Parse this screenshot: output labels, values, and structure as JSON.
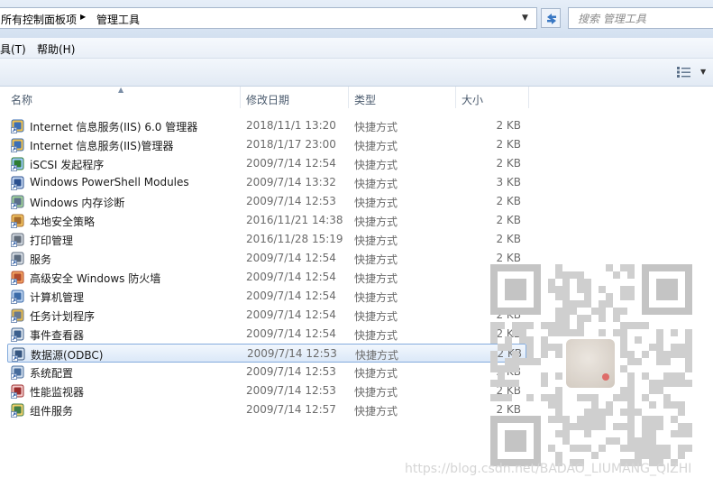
{
  "window": {
    "breadcrumb": [
      "所有控制面板项",
      "管理工具"
    ],
    "search_placeholder": "搜索 管理工具"
  },
  "menu": [
    {
      "label": "具(T)"
    },
    {
      "label": "帮助(H)"
    }
  ],
  "columns": [
    {
      "key": "name",
      "label": "名称"
    },
    {
      "key": "date",
      "label": "修改日期"
    },
    {
      "key": "type",
      "label": "类型"
    },
    {
      "key": "size",
      "label": "大小"
    }
  ],
  "files": [
    {
      "name": "Internet 信息服务(IIS) 6.0 管理器",
      "date": "2018/11/1 13:20",
      "type": "快捷方式",
      "size": "2 KB",
      "icon": "iis-icon"
    },
    {
      "name": "Internet 信息服务(IIS)管理器",
      "date": "2018/1/17 23:00",
      "type": "快捷方式",
      "size": "2 KB",
      "icon": "iis-icon"
    },
    {
      "name": "iSCSI 发起程序",
      "date": "2009/7/14 12:54",
      "type": "快捷方式",
      "size": "2 KB",
      "icon": "iscsi-icon"
    },
    {
      "name": "Windows PowerShell Modules",
      "date": "2009/7/14 13:32",
      "type": "快捷方式",
      "size": "3 KB",
      "icon": "powershell-icon"
    },
    {
      "name": "Windows 内存诊断",
      "date": "2009/7/14 12:53",
      "type": "快捷方式",
      "size": "2 KB",
      "icon": "memory-diagnostic-icon"
    },
    {
      "name": "本地安全策略",
      "date": "2016/11/21 14:38",
      "type": "快捷方式",
      "size": "2 KB",
      "icon": "security-policy-icon"
    },
    {
      "name": "打印管理",
      "date": "2016/11/28 15:19",
      "type": "快捷方式",
      "size": "2 KB",
      "icon": "printer-icon"
    },
    {
      "name": "服务",
      "date": "2009/7/14 12:54",
      "type": "快捷方式",
      "size": "2 KB",
      "icon": "services-icon"
    },
    {
      "name": "高级安全 Windows 防火墙",
      "date": "2009/7/14 12:54",
      "type": "快捷方式",
      "size": "2 KB",
      "icon": "firewall-icon"
    },
    {
      "name": "计算机管理",
      "date": "2009/7/14 12:54",
      "type": "快捷方式",
      "size": "2 KB",
      "icon": "computer-management-icon"
    },
    {
      "name": "任务计划程序",
      "date": "2009/7/14 12:54",
      "type": "快捷方式",
      "size": "2 KB",
      "icon": "task-scheduler-icon"
    },
    {
      "name": "事件查看器",
      "date": "2009/7/14 12:54",
      "type": "快捷方式",
      "size": "2 KB",
      "icon": "event-viewer-icon"
    },
    {
      "name": "数据源(ODBC)",
      "date": "2009/7/14 12:53",
      "type": "快捷方式",
      "size": "2 KB",
      "icon": "odbc-icon",
      "selected": true
    },
    {
      "name": "系统配置",
      "date": "2009/7/14 12:53",
      "type": "快捷方式",
      "size": "2 KB",
      "icon": "system-config-icon"
    },
    {
      "name": "性能监视器",
      "date": "2009/7/14 12:53",
      "type": "快捷方式",
      "size": "2 KB",
      "icon": "performance-monitor-icon"
    },
    {
      "name": "组件服务",
      "date": "2009/7/14 12:57",
      "type": "快捷方式",
      "size": "2 KB",
      "icon": "component-services-icon"
    }
  ],
  "watermark": "https://blog.csdn.net/BADAO_LIUMANG_QIZHI",
  "colors": {
    "selection_border": "#84acdd",
    "selection_fill": "#dbe8f8",
    "header_text": "#4b5b6e",
    "secondary_text": "#6b6b6b"
  }
}
